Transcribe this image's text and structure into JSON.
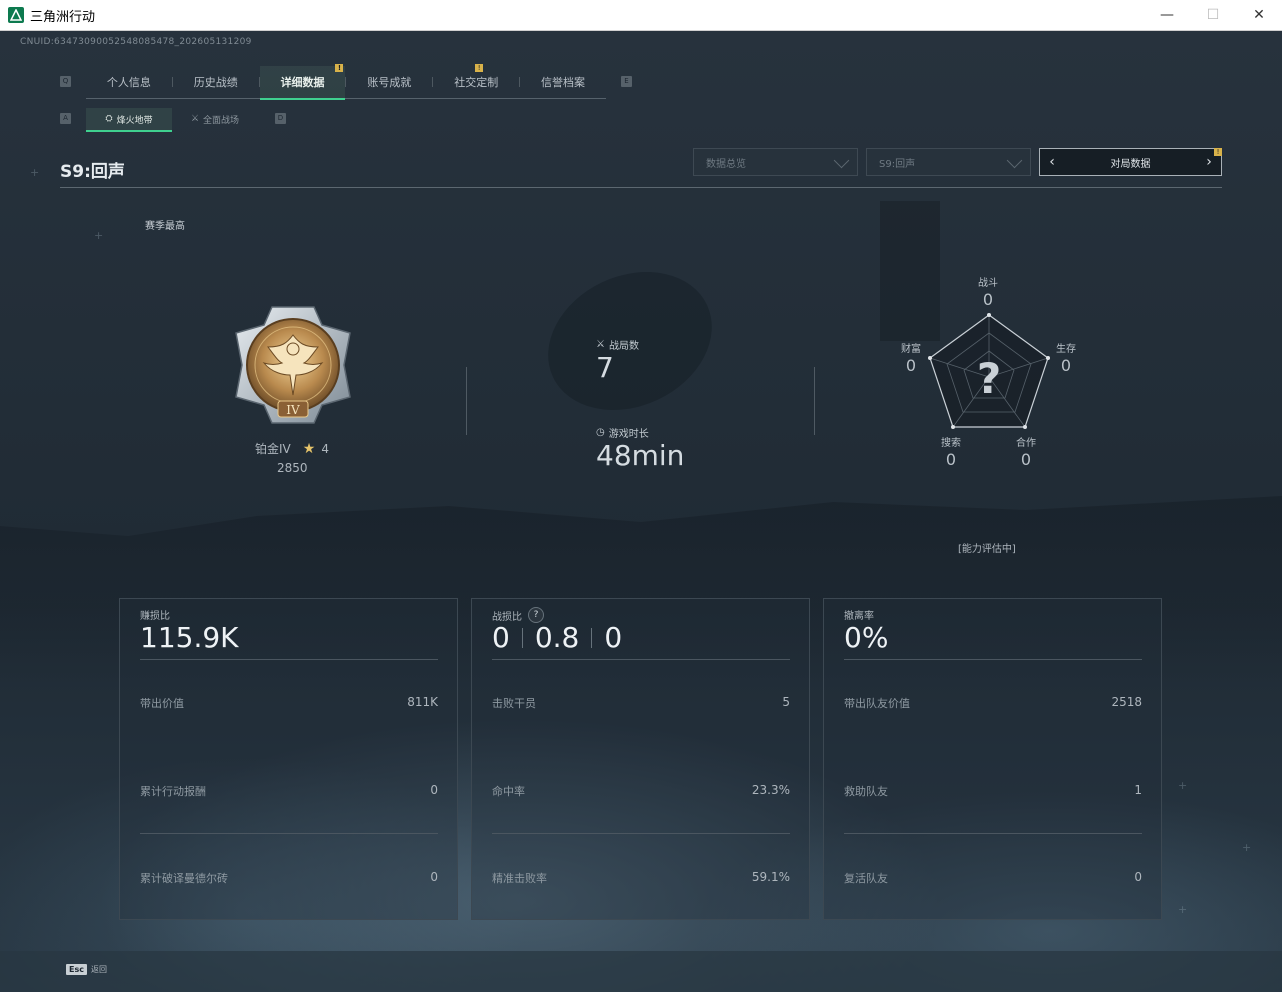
{
  "window": {
    "title": "三角洲行动",
    "minimize": "—",
    "maximize": "☐",
    "close": "✕"
  },
  "cnuid": "CNUID:6347309005254808547​8_202605131209",
  "tabs": {
    "left_key": "Q",
    "right_key": "E",
    "items": [
      {
        "label": "个人信息",
        "active": false,
        "badge": false
      },
      {
        "label": "历史战绩",
        "active": false,
        "badge": false
      },
      {
        "label": "详细数据",
        "active": true,
        "badge": true
      },
      {
        "label": "账号成就",
        "active": false,
        "badge": false
      },
      {
        "label": "社交定制",
        "active": false,
        "badge": true
      },
      {
        "label": "信誉档案",
        "active": false,
        "badge": false
      }
    ]
  },
  "subtabs": {
    "left_key": "A",
    "right_key": "D",
    "items": [
      {
        "label": "烽火地带",
        "active": true
      },
      {
        "label": "全面战场",
        "active": false
      }
    ]
  },
  "page_title": "S9:回声",
  "filters": {
    "data_scope": "数据总览",
    "season": "S9:回声",
    "pager_label": "对局数据",
    "prev": "‹",
    "next": "›"
  },
  "season_best": "赛季最高",
  "rank": {
    "name": "铂金IV",
    "stars": "4",
    "score": "2850",
    "numeral": "IV"
  },
  "stats": {
    "matches_label": "战局数",
    "matches_value": "7",
    "playtime_label": "游戏时长",
    "playtime_value": "48min"
  },
  "radar": {
    "combat_label": "战斗",
    "combat_value": "0",
    "survival_label": "生存",
    "survival_value": "0",
    "coop_label": "合作",
    "coop_value": "0",
    "search_label": "搜索",
    "search_value": "0",
    "wealth_label": "财富",
    "wealth_value": "0",
    "center": "?",
    "status": "[能力评估中]"
  },
  "cards": [
    {
      "label": "赚损比",
      "big": "115.9K",
      "rows": [
        {
          "label": "带出价值",
          "value": "811K"
        },
        {
          "label": "累计行动报酬",
          "value": "0"
        },
        {
          "label": "累计破译曼德尔砖",
          "value": "0"
        }
      ]
    },
    {
      "label": "战损比",
      "help": "?",
      "big_parts": [
        "0",
        "0.8",
        "0"
      ],
      "rows": [
        {
          "label": "击败干员",
          "value": "5"
        },
        {
          "label": "命中率",
          "value": "23.3%"
        },
        {
          "label": "精准击败率",
          "value": "59.1%"
        }
      ]
    },
    {
      "label": "撤离率",
      "big": "0%",
      "rows": [
        {
          "label": "带出队友价值",
          "value": "2518"
        },
        {
          "label": "救助队友",
          "value": "1"
        },
        {
          "label": "复活队友",
          "value": "0"
        }
      ]
    }
  ],
  "footer": {
    "esc_key": "Esc",
    "esc_label": "返回"
  },
  "colors": {
    "accent": "#3fd08f",
    "badge": "#d8b24a",
    "background": "#1c2630"
  }
}
